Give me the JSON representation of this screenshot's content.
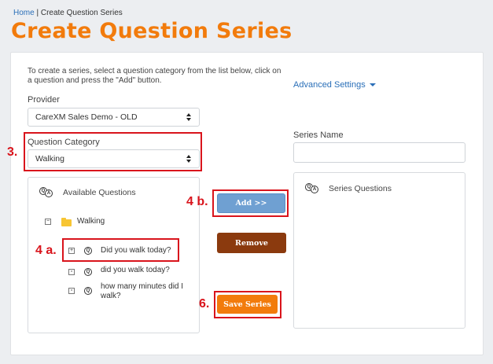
{
  "breadcrumb": {
    "home": "Home",
    "separator": " | ",
    "current": "Create Question Series"
  },
  "page_title": "Create Question Series",
  "intro_text": "To create a series, select a question category from the list below, click on a question and press the \"Add\" button.",
  "advanced_settings": "Advanced Settings",
  "provider": {
    "label": "Provider",
    "value": "CareXM Sales Demo - OLD"
  },
  "category": {
    "label": "Question Category",
    "value": "Walking"
  },
  "series_name": {
    "label": "Series Name",
    "value": ""
  },
  "available": {
    "title": "Available Questions",
    "folder": {
      "toggle": "−",
      "label": "Walking"
    },
    "items": [
      {
        "toggle": "+",
        "label": "Did you walk today?"
      },
      {
        "toggle": "▫",
        "label": "did you walk today?"
      },
      {
        "toggle": "▫",
        "label": "how many minutes did I walk?"
      }
    ]
  },
  "series_box": {
    "title": "Series Questions"
  },
  "buttons": {
    "add": "Add >>",
    "remove": "Remove",
    "save": "Save Series"
  },
  "annotations": {
    "step3": "3.",
    "step4a": "4 a.",
    "step4b": "4 b.",
    "step6": "6."
  },
  "icons": {
    "qa": "qa-icon",
    "q": "question-icon",
    "folder": "folder-icon"
  },
  "colors": {
    "accent": "#f27b0c",
    "link": "#2a6fb8",
    "highlight": "#d9141c",
    "add": "#6fa0d2",
    "remove": "#8b3a0e"
  }
}
